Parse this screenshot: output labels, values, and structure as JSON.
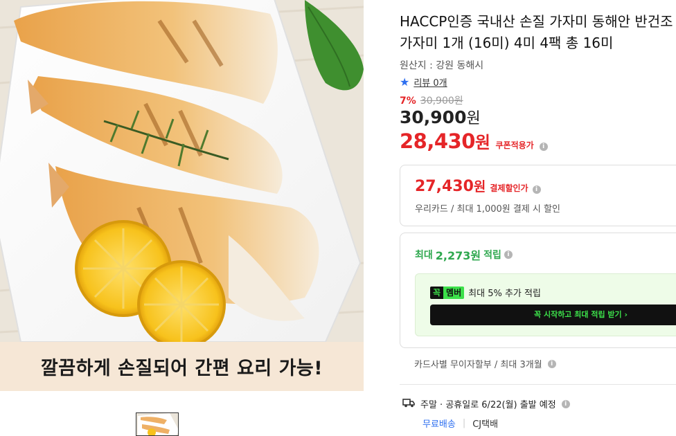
{
  "product": {
    "image_caption": "깔끔하게 손질되어 간편 요리 가능!",
    "title_line1": "HACCP인증 국내산 손질 가자미 동해안 반건조",
    "title_line2": "가자미 1개 (16미) 4미 4팩 총 16미",
    "origin": "원산지 : 강원 동해시",
    "review_label": "리뷰 0개"
  },
  "pricing": {
    "discount_rate": "7%",
    "original_price": "30,900원",
    "price_value": "30,900",
    "price_unit": "원",
    "coupon_value": "28,430",
    "coupon_unit": "원",
    "coupon_label": "쿠폰적용가"
  },
  "payment_discount": {
    "value": "27,430",
    "unit": "원",
    "label": "결제할인가",
    "note": "우리카드 / 최대 1,000원 결제 시 할인"
  },
  "points": {
    "prefix": "최대",
    "amount": "2,273원",
    "suffix": "적립",
    "member_tag_left": "꼭",
    "member_tag_right": "멤버",
    "member_text": "최대 5% 추가 적립",
    "member_cta": "꼭 시작하고 최대 적립 받기 ›"
  },
  "installment": "카드사별 무이자할부 / 최대 3개월",
  "shipping": {
    "dispatch": "주말 · 공휴일로 6/22(월) 출발 예정",
    "free_label": "무료배송",
    "carrier": "CJ택배"
  },
  "colors": {
    "sale_red": "#e52528",
    "point_green": "#2fa84f",
    "member_green": "#3ce04a",
    "link_blue": "#2e6ff0"
  },
  "icons": [
    "star-icon",
    "info-icon",
    "truck-icon"
  ]
}
